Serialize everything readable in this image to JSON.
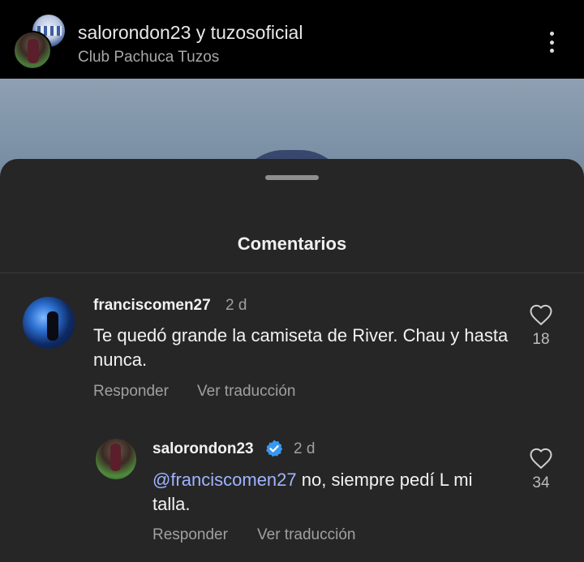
{
  "header": {
    "title": "salorondon23 y tuzosoficial",
    "subtitle": "Club Pachuca Tuzos"
  },
  "sheet": {
    "title": "Comentarios"
  },
  "comments": [
    {
      "user": "franciscomen27",
      "time": "2 d",
      "text": "Te quedó grande la camiseta de River. Chau  y hasta nunca.",
      "reply_label": "Responder",
      "translate_label": "Ver traducción",
      "likes": "18"
    },
    {
      "user": "salorondon23",
      "verified": true,
      "time": "2 d",
      "mention": "@franciscomen27",
      "text": " no, siempre pedí L mi talla.",
      "reply_label": "Responder",
      "translate_label": "Ver traducción",
      "likes": "34"
    }
  ],
  "colors": {
    "background": "#000000",
    "sheet": "#262626",
    "mention": "#9fb4ff",
    "verified": "#3897f0"
  }
}
